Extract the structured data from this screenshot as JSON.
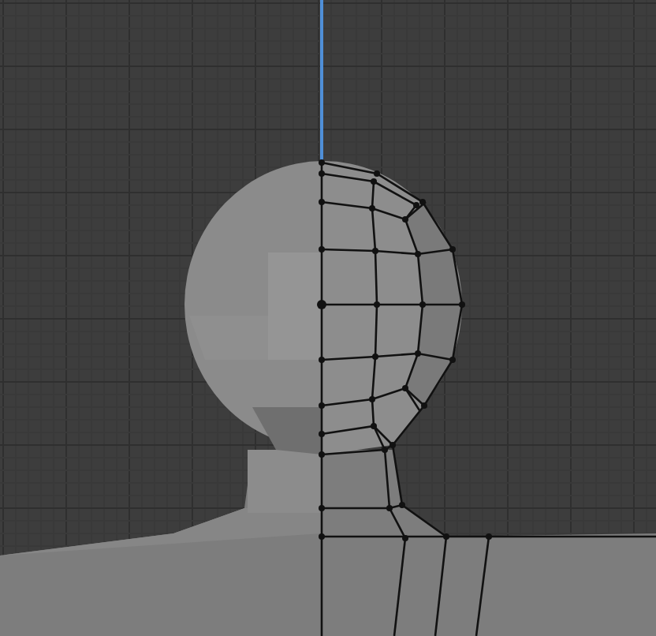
{
  "viewport": {
    "grid_visible": true,
    "z_axis_visible": true,
    "wireframe_visible": true
  }
}
